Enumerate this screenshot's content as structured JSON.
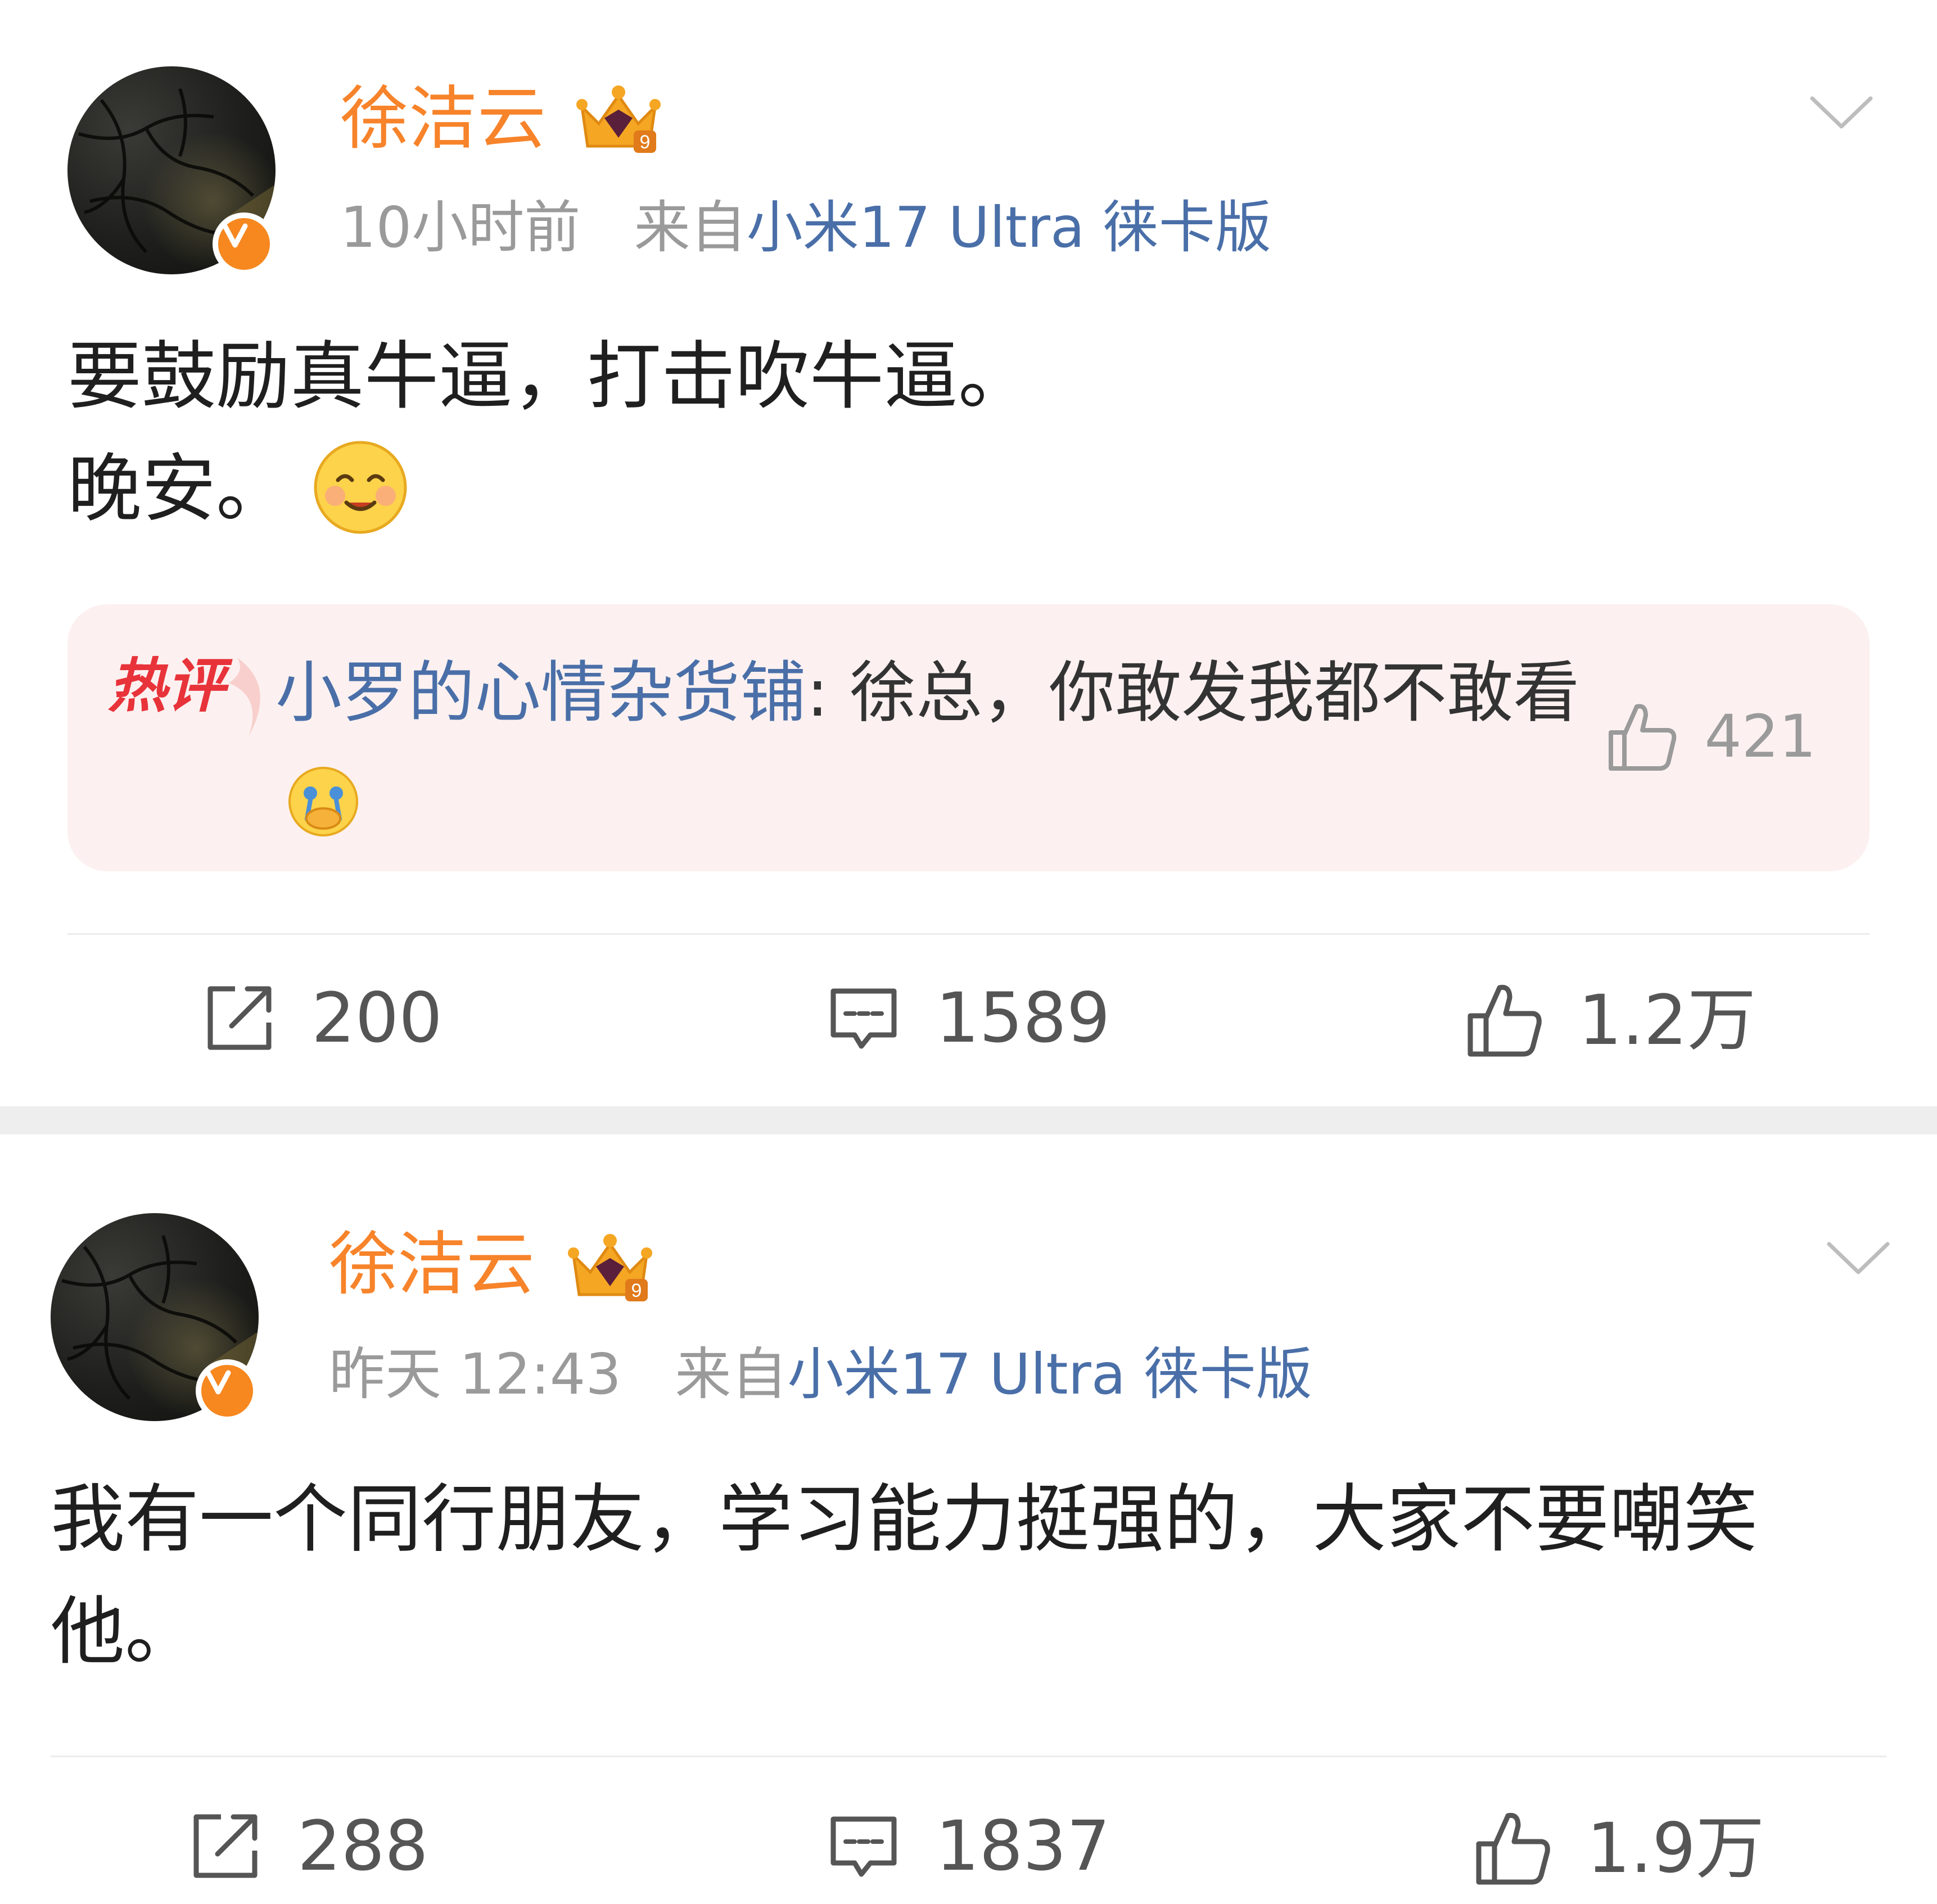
{
  "posts": [
    {
      "username": "徐洁云",
      "time": "10小时前",
      "source_prefix": "来自",
      "source_device": "小米17 Ultra 徕卡版",
      "text_lines": [
        "要鼓励真牛逼，打击吹牛逼。",
        "晚安。"
      ],
      "text_emoji": "smile-emoji",
      "hot_comment": {
        "tag": "热评",
        "commenter": "小罗的心情杂货铺",
        "separator": ": ",
        "content": "徐总，你敢发我都不敢看",
        "emoji": "cry-emoji",
        "likes": "421"
      },
      "actions": {
        "reposts": "200",
        "comments": "1589",
        "likes": "1.2万"
      }
    },
    {
      "username": "徐洁云",
      "time": "昨天 12:43",
      "source_prefix": "来自",
      "source_device": "小米17 Ultra 徕卡版",
      "text_lines": [
        "我有一个同行朋友，学习能力挺强的，大家不要嘲笑",
        "他。"
      ],
      "actions": {
        "reposts": "288",
        "comments": "1837",
        "likes": "1.9万"
      }
    }
  ],
  "colors": {
    "username": "#f7832a",
    "device_link": "#4a6fa8",
    "hot_tag": "#e8333a",
    "hot_bg": "#fcf1f0",
    "verified_badge": "#f7871f"
  }
}
